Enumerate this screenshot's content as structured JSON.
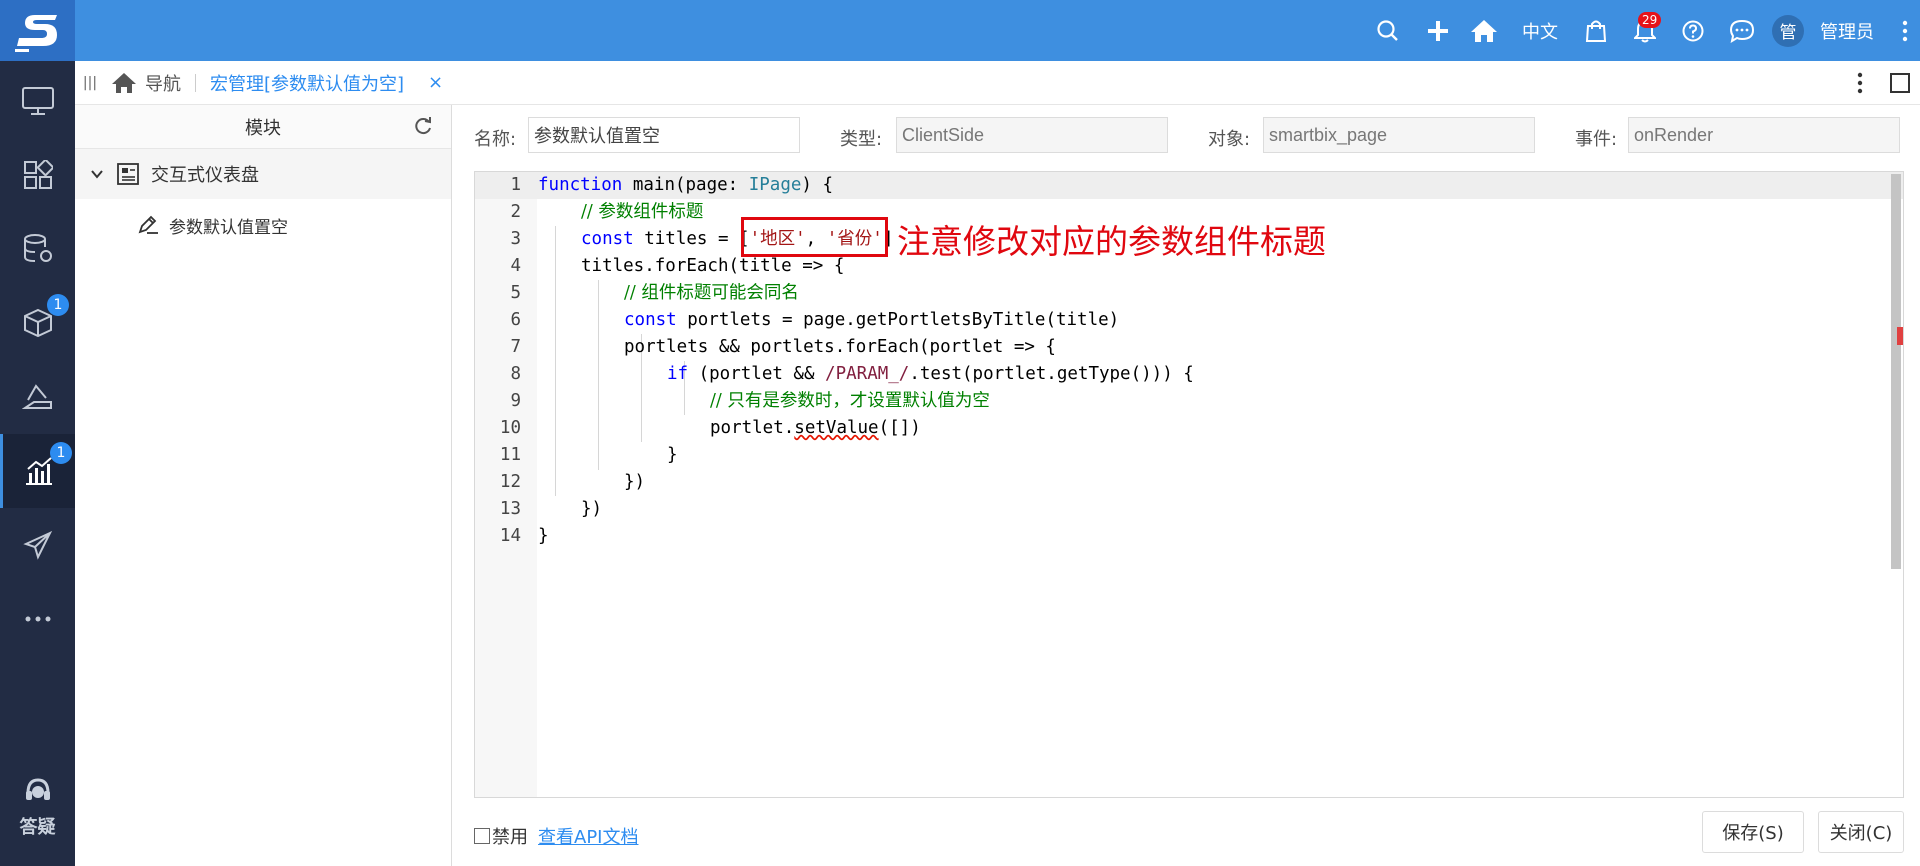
{
  "topbar": {
    "language": "中文",
    "notification_count": "29",
    "avatar_char": "管",
    "username": "管理员"
  },
  "sidebar": {
    "badges": {
      "resources": "1",
      "analysis": "1"
    },
    "help_label": "答疑"
  },
  "tabbar": {
    "nav_label": "导航",
    "active_tab": "宏管理[参数默认值为空]",
    "close_glyph": "×"
  },
  "left_panel": {
    "title": "模块",
    "tree_root": "交互式仪表盘",
    "tree_child": "参数默认值置空"
  },
  "form": {
    "name_label": "名称:",
    "name_value": "参数默认值置空",
    "type_label": "类型:",
    "type_value": "ClientSide",
    "object_label": "对象:",
    "object_value": "smartbix_page",
    "event_label": "事件:",
    "event_value": "onRender"
  },
  "code": {
    "line_numbers": [
      "1",
      "2",
      "3",
      "4",
      "5",
      "6",
      "7",
      "8",
      "9",
      "10",
      "11",
      "12",
      "13",
      "14"
    ],
    "l1": {
      "kw": "function",
      "a": " main(page: ",
      "ty": "IPage",
      "b": ") {"
    },
    "l2": {
      "cm": "// 参数组件标题"
    },
    "l3": {
      "kw": "const",
      "a": " titles = [",
      "s1": "'地区'",
      "c": ", ",
      "s2": "'省份'",
      "b": "]"
    },
    "l4": {
      "a": "titles.forEach(title => {"
    },
    "l5": {
      "cm": "// 组件标题可能会同名"
    },
    "l6": {
      "kw": "const",
      "a": " portlets = page.getPortletsByTitle(title)"
    },
    "l7": {
      "a": "portlets && portlets.forEach(portlet => {"
    },
    "l8": {
      "kw": "if",
      "a": " (portlet && ",
      "rx": "/PARAM_/",
      "b": ".test(portlet.getType())) {"
    },
    "l9": {
      "cm": "// 只有是参数时，才设置默认值为空"
    },
    "l10": {
      "a": "portlet.",
      "sq": "setValue",
      "b": "([])"
    },
    "l11": {
      "a": "}"
    },
    "l12": {
      "a": "})"
    },
    "l13": {
      "a": "})"
    },
    "l14": {
      "a": "}"
    }
  },
  "annotation": "注意修改对应的参数组件标题",
  "bottom": {
    "disable_label": "禁用",
    "api_link": "查看API文档",
    "save_label": "保存(S)",
    "close_label": "关闭(C)"
  }
}
